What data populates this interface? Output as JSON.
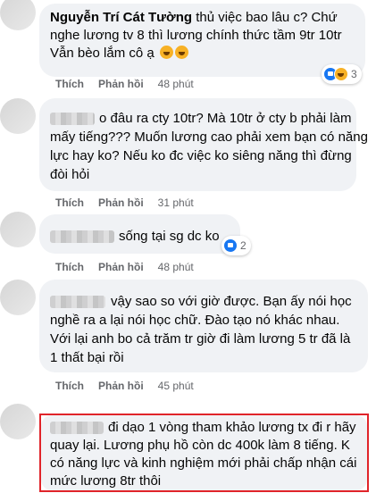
{
  "comments": [
    {
      "author": "Nguyễn Trí Cát Tường",
      "lines": [
        "thủ việc bao lâu c? Chứ",
        "nghe lương tv 8 thì lương chính thức tầm 9tr 10tr",
        "Vẫn bèo lắm cô ạ"
      ],
      "emoji": "haha-emoji",
      "reaction_count": "3",
      "like": "Thích",
      "reply": "Phản hồi",
      "time": "48 phút"
    },
    {
      "lines": [
        "o đâu ra cty 10tr? Mà 10tr ở cty b phải làm",
        "mấy tiếng??? Muốn lương cao phải xem bạn có năng",
        "lực hay ko? Nếu ko đc việc ko siêng năng thì đừng",
        "đòi hỏi"
      ],
      "like": "Thích",
      "reply": "Phản hồi",
      "time": "31 phút"
    },
    {
      "lines": [
        "sống tại sg dc ko"
      ],
      "reaction_count": "2",
      "like": "Thích",
      "reply": "Phản hồi",
      "time": "48 phút"
    },
    {
      "lines": [
        "vậy sao so với giờ được. Bạn ấy nói học",
        "nghề ra a lại nói học chữ. Đào tạo nó khác nhau.",
        "Với lại anh bo cả trăm tr giờ đi làm lương 5 tr đã là",
        "1 thất bại rồi"
      ],
      "like": "Thích",
      "reply": "Phản hồi",
      "time": "45 phút"
    },
    {
      "lines": [
        "đi dạo 1 vòng tham khảo lương tx đi r hãy",
        "quay lại. Lương phụ hồ còn dc 400k làm 8 tiếng. K",
        "có năng lực và kinh nghiệm mới phải chấp nhận cái",
        "mức lương 8tr thôi"
      ]
    }
  ],
  "colors": {
    "bubble": "#f0f2f5",
    "highlight": "#e0242a",
    "muted": "#65676b",
    "like_blue": "#1877f2"
  }
}
